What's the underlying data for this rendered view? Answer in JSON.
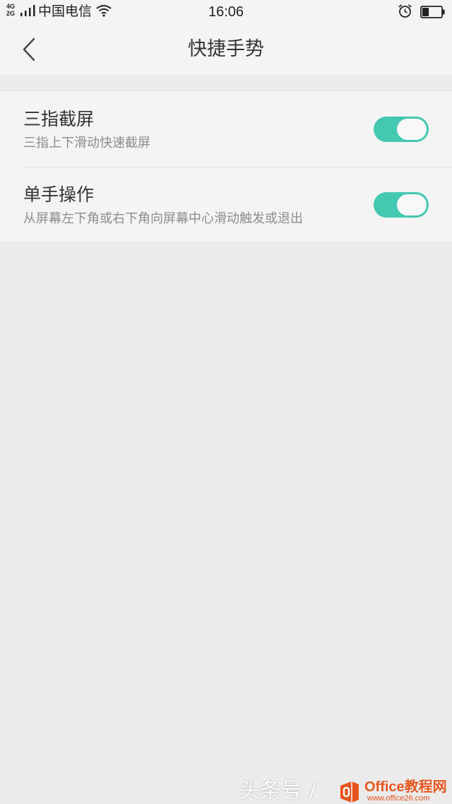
{
  "status_bar": {
    "network_type_top": "4G",
    "network_type_bottom": "2G",
    "carrier": "中国电信",
    "time": "16:06",
    "battery_level": 0.35,
    "icons": [
      "signal-icon",
      "wifi-icon",
      "alarm-icon",
      "battery-icon"
    ]
  },
  "header": {
    "title": "快捷手势",
    "back_icon": "chevron-left-icon"
  },
  "settings": [
    {
      "title": "三指截屏",
      "subtitle": "三指上下滑动快速截屏",
      "enabled": true
    },
    {
      "title": "单手操作",
      "subtitle": "从屏幕左下角或右下角向屏幕中心滑动触发或退出",
      "enabled": true
    }
  ],
  "watermark": {
    "text": "头条号 /",
    "brand": "Office教程网",
    "url": "www.office26.com"
  },
  "colors": {
    "accent": "#43c8b2",
    "background": "#ebebeb",
    "panel": "#f4f4f4",
    "watermark_brand": "#e8541e"
  }
}
